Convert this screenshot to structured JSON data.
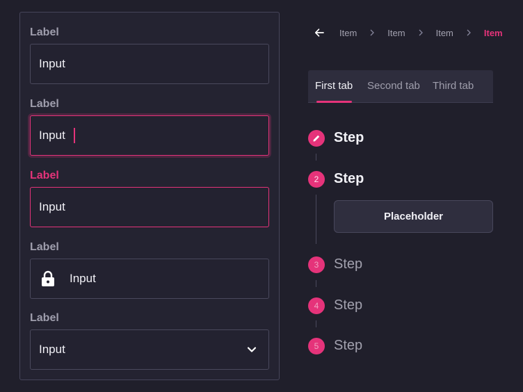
{
  "form": {
    "fields": [
      {
        "label": "Label",
        "value": "Input",
        "state": "default"
      },
      {
        "label": "Label",
        "value": "Input",
        "state": "focused"
      },
      {
        "label": "Label",
        "value": "Input",
        "state": "error"
      },
      {
        "label": "Label",
        "value": "Input",
        "state": "default",
        "icon": "lock-icon"
      },
      {
        "label": "Label",
        "value": "Input",
        "state": "default",
        "icon": "chevron-down-icon"
      }
    ]
  },
  "breadcrumb": {
    "back_icon": "arrow-left-icon",
    "items": [
      "Item",
      "Item",
      "Item",
      "Item"
    ],
    "active_index": 3
  },
  "tabs": {
    "items": [
      "First tab",
      "Second tab",
      "Third tab"
    ],
    "active_index": 0
  },
  "stepper": {
    "steps": [
      {
        "number": "",
        "icon": "pencil-icon",
        "label": "Step",
        "active": true
      },
      {
        "number": "2",
        "label": "Step",
        "active": true
      },
      {
        "number": "3",
        "label": "Step",
        "active": false
      },
      {
        "number": "4",
        "label": "Step",
        "active": false
      },
      {
        "number": "5",
        "label": "Step",
        "active": false
      }
    ],
    "placeholder_button": "Placeholder"
  },
  "colors": {
    "accent": "#e5337a",
    "background": "#201f2b",
    "panel": "#242331"
  }
}
